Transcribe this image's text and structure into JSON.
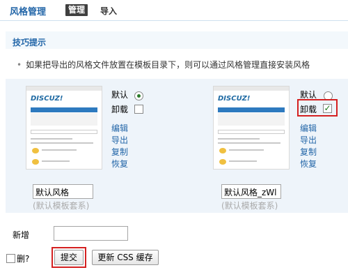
{
  "header": {
    "title": "风格管理",
    "tabs": [
      {
        "label": "管理",
        "active": true
      },
      {
        "label": "导入",
        "active": false
      }
    ]
  },
  "tips": {
    "title": "技巧提示",
    "bullet": "•",
    "text": "如果把导出的风格文件放置在模板目录下，则可以通过风格管理直接安装风格"
  },
  "styles": [
    {
      "default_label": "默认",
      "default_checked": true,
      "uninstall_label": "卸载",
      "uninstall_checked": false,
      "actions": [
        "编辑",
        "导出",
        "复制",
        "恢复"
      ],
      "name_value": "默认风格",
      "caption": "(默认模板套系)",
      "thumb_logo": "DISCUZ!"
    },
    {
      "default_label": "默认",
      "default_checked": false,
      "uninstall_label": "卸载",
      "uninstall_checked": true,
      "actions": [
        "编辑",
        "导出",
        "复制",
        "恢复"
      ],
      "name_value": "默认风格_zWl",
      "caption": "(默认模板套系)",
      "thumb_logo": "DISCUZ!"
    }
  ],
  "footer": {
    "new_label": "新增",
    "new_value": "",
    "delete_label": "删?",
    "submit_label": "提交",
    "refresh_css_label": "更新 CSS 缓存"
  },
  "colors": {
    "accent": "#2366a8",
    "highlight": "#d42020",
    "section_bg": "#eef4fa"
  }
}
